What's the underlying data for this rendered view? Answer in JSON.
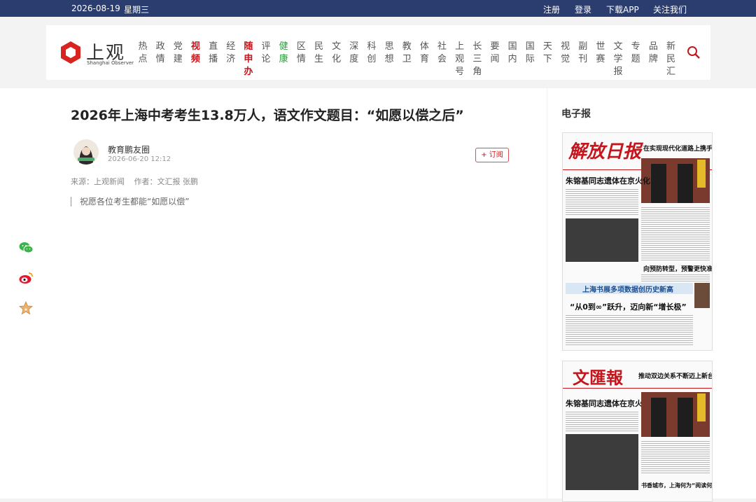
{
  "topbar": {
    "date": "2026-08-19",
    "weekday": "星期三",
    "links": [
      "注册",
      "登录",
      "下载APP",
      "关注我们"
    ]
  },
  "logo": {
    "cn": "上观",
    "en": "Shanghai Observer"
  },
  "nav": [
    {
      "label": "热点"
    },
    {
      "label": "政情"
    },
    {
      "label": "党建"
    },
    {
      "label": "视频",
      "style": "red"
    },
    {
      "label": "直播"
    },
    {
      "label": "经济"
    },
    {
      "label": "随申办",
      "style": "red"
    },
    {
      "label": "评论"
    },
    {
      "label": "健康",
      "style": "green"
    },
    {
      "label": "区情"
    },
    {
      "label": "民生"
    },
    {
      "label": "文化"
    },
    {
      "label": "深度"
    },
    {
      "label": "科创"
    },
    {
      "label": "思想"
    },
    {
      "label": "教卫"
    },
    {
      "label": "体育"
    },
    {
      "label": "社会"
    },
    {
      "label": "上观号"
    },
    {
      "label": "长三角"
    },
    {
      "label": "要闻"
    },
    {
      "label": "国内"
    },
    {
      "label": "国际"
    },
    {
      "label": "天下"
    },
    {
      "label": "视觉"
    },
    {
      "label": "副刊"
    },
    {
      "label": "世赛"
    },
    {
      "label": "文学报"
    },
    {
      "label": "专题"
    },
    {
      "label": "品牌"
    },
    {
      "label": "新民汇"
    }
  ],
  "article": {
    "title": "2026年上海中考考生13.8万人，语文作文题目：“如愿以偿之后”",
    "author": "教育鹏友圈",
    "time": "2026-06-20 12:12",
    "subscribe": "+ 订阅",
    "source": "来源：上观新闻",
    "writer": "作者：文汇报 张鹏",
    "quote": "祝愿各位考生都能“如愿以偿”"
  },
  "sidebar": {
    "title": "电子报",
    "papers": [
      {
        "masthead": "解放日报",
        "top_headline": "在实现现代化道路上携手同行",
        "headline": "朱镕基同志遗体在京火化",
        "sub_headline": "向预防转型，预警更快准",
        "banner": "上海书展多项数据创历史新高",
        "big_quote": "“从0到∞”跃升，迈向新“增长极”"
      },
      {
        "masthead": "文匯報",
        "top_headline": "推动双边关系不断迈上新台阶",
        "headline": "朱镕基同志遗体在京火化",
        "sub_headline": "书香城市，上海何为“阅读何为”"
      }
    ]
  }
}
